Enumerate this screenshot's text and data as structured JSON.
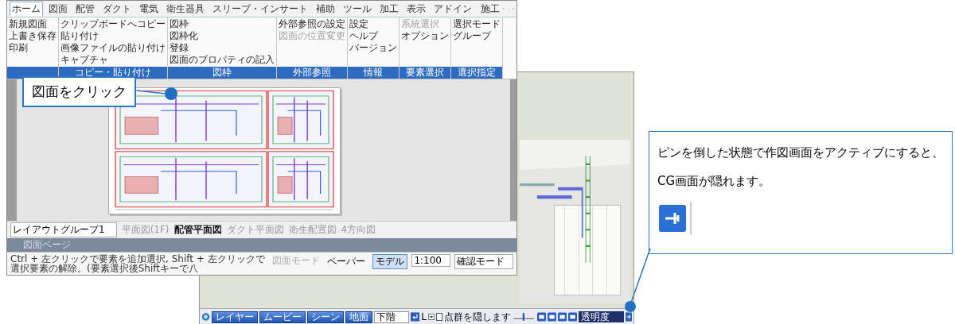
{
  "app_window": {
    "ribbon_tabs": [
      {
        "label": "ホーム",
        "selected": true
      },
      {
        "label": "図面",
        "selected": false
      },
      {
        "label": "配管",
        "selected": false
      },
      {
        "label": "ダクト",
        "selected": false
      },
      {
        "label": "電気",
        "selected": false
      },
      {
        "label": "衛生器具",
        "selected": false
      },
      {
        "label": "スリーブ・インサート",
        "selected": false
      },
      {
        "label": "補助",
        "selected": false
      },
      {
        "label": "ツール",
        "selected": false
      },
      {
        "label": "加工",
        "selected": false
      },
      {
        "label": "表示",
        "selected": false
      },
      {
        "label": "アドイン",
        "selected": false
      }
    ],
    "work_mode": "施工",
    "ribbon_groups": [
      {
        "items": [
          {
            "label": "新規図面",
            "disabled": false
          },
          {
            "label": "上書き保存",
            "disabled": false
          },
          {
            "label": "印刷",
            "disabled": false
          }
        ]
      },
      {
        "label": "コピー・貼り付け",
        "items": [
          {
            "label": "クリップボードへコピー",
            "disabled": false
          },
          {
            "label": "貼り付け",
            "disabled": false
          },
          {
            "label": "画像ファイルの貼り付け",
            "disabled": false
          },
          {
            "label": "キャプチャ",
            "disabled": false
          }
        ]
      },
      {
        "label": "図枠",
        "items": [
          {
            "label": "図枠",
            "disabled": false
          },
          {
            "label": "図枠化",
            "disabled": false
          },
          {
            "label": "登録",
            "disabled": false
          },
          {
            "label": "図面のプロパティの記入",
            "disabled": false
          }
        ]
      },
      {
        "label": "外部参照",
        "items": [
          {
            "label": "外部参照の設定",
            "disabled": false
          },
          {
            "label": "図面の位置変更",
            "disabled": true
          }
        ]
      },
      {
        "label": "情報",
        "items": [
          {
            "label": "設定",
            "disabled": false
          },
          {
            "label": "ヘルプ",
            "disabled": false
          },
          {
            "label": "バージョン",
            "disabled": false
          }
        ]
      },
      {
        "label": "要素選択",
        "items": [
          {
            "label": "系統選択",
            "disabled": true
          },
          {
            "label": "オプション",
            "disabled": false
          }
        ]
      },
      {
        "label": "選択指定",
        "items": [
          {
            "label": "選択モード",
            "disabled": false
          },
          {
            "label": "グループ",
            "disabled": false
          }
        ]
      }
    ],
    "layout_group": "レイアウトグループ1",
    "layout_tabs": [
      {
        "label": "平面図(1F)",
        "selected": false
      },
      {
        "label": "配管平面図",
        "selected": true
      },
      {
        "label": "ダクト平面図",
        "selected": false
      },
      {
        "label": "衛生配置図",
        "selected": false
      },
      {
        "label": "4方向図",
        "selected": false
      }
    ],
    "page_tab": "図面ページ",
    "status": {
      "message": "Ctrl + 左クリックで要素を追加選択, Shift + 左クリックで選択要素の解除。(要素選択後Shiftキーで八",
      "mode_hint": "図面モード",
      "spaces": [
        {
          "label": "ペーパー",
          "selected": false
        },
        {
          "label": "モデル",
          "selected": true
        }
      ],
      "scale": "1:100",
      "view_mode": "確認モード"
    }
  },
  "cg_window": {
    "toolbar": {
      "buttons": [
        "レイヤー",
        "ムービー",
        "シーン",
        "地面"
      ],
      "floor_select": "下階",
      "axis_label": "L",
      "hide_option": {
        "label": "点群を隠します",
        "checked": false
      },
      "transparency": "透明度"
    }
  },
  "callouts": [
    {
      "text": "図面をクリック"
    },
    {
      "text": "ピンを倒した状態で作図画面をアクティブにすると、CG画面が隠れます。"
    }
  ]
}
